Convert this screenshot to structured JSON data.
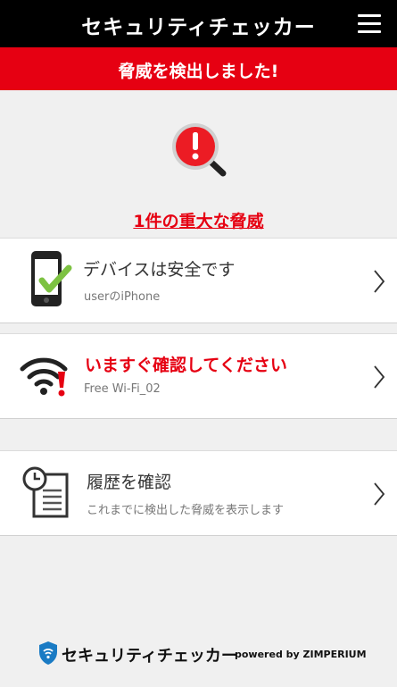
{
  "header": {
    "title": "セキュリティチェッカー"
  },
  "alert": {
    "message": "脅威を検出しました!"
  },
  "summary": {
    "threat_count_text": "1件の重大な脅威"
  },
  "cards": {
    "device": {
      "title": "デバイスは安全です",
      "subtitle": "userのiPhone"
    },
    "wifi": {
      "title": "いますぐ確認してください",
      "subtitle": "Free Wi-Fi_02"
    },
    "history": {
      "title": "履歴を確認",
      "subtitle": "これまでに検出した脅威を表示します"
    }
  },
  "footer": {
    "brand": "セキュリティチェッカー",
    "powered_by": "powered by ZIMPERIUM"
  },
  "colors": {
    "accent_red": "#e60012",
    "check_green": "#7dc242",
    "header_black": "#000000"
  },
  "icons": [
    "menu-icon",
    "magnifier-alert-icon",
    "phone-check-icon",
    "wifi-warning-icon",
    "clock-document-icon",
    "chevron-right-icon",
    "shield-wifi-icon"
  ]
}
